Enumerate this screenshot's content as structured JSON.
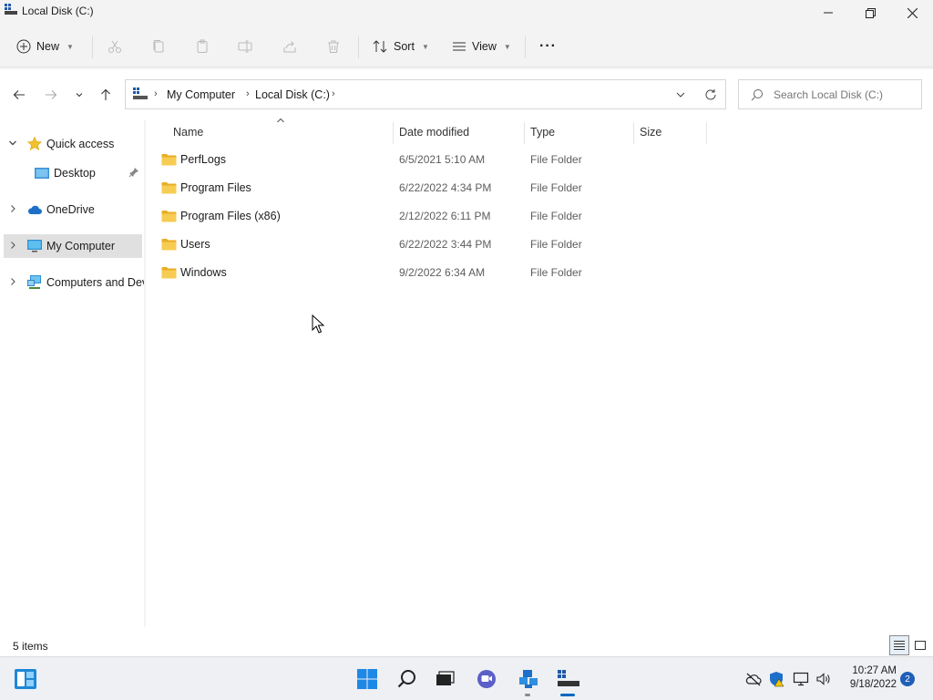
{
  "window": {
    "title": "Local Disk (C:)"
  },
  "commandbar": {
    "new_label": "New",
    "sort_label": "Sort",
    "view_label": "View",
    "more_label": "···"
  },
  "address": {
    "crumbs": [
      "My Computer",
      "Local Disk (C:)"
    ],
    "separator": "›"
  },
  "search": {
    "placeholder": "Search Local Disk (C:)"
  },
  "navpane": {
    "items": [
      {
        "label": "Quick access",
        "icon": "star-icon"
      },
      {
        "label": "Desktop",
        "icon": "desktop-folder-icon"
      },
      {
        "label": "OneDrive",
        "icon": "cloud-icon"
      },
      {
        "label": "My Computer",
        "icon": "computer-icon"
      },
      {
        "label": "Computers and Devices",
        "icon": "network-icon"
      }
    ]
  },
  "filelist": {
    "columns": [
      "Name",
      "Date modified",
      "Type",
      "Size"
    ],
    "rows": [
      {
        "name": "PerfLogs",
        "date": "6/5/2021 5:10 AM",
        "type": "File Folder",
        "size": ""
      },
      {
        "name": "Program Files",
        "date": "6/22/2022 4:34 PM",
        "type": "File Folder",
        "size": ""
      },
      {
        "name": "Program Files (x86)",
        "date": "2/12/2022 6:11 PM",
        "type": "File Folder",
        "size": ""
      },
      {
        "name": "Users",
        "date": "6/22/2022 3:44 PM",
        "type": "File Folder",
        "size": ""
      },
      {
        "name": "Windows",
        "date": "9/2/2022 6:34 AM",
        "type": "File Folder",
        "size": ""
      }
    ]
  },
  "status": {
    "item_count": "5 items"
  },
  "taskbar": {
    "time": "10:27 AM",
    "date": "9/18/2022",
    "notification_count": "2"
  },
  "colors": {
    "accent": "#0067c0",
    "folder": "#f3c445",
    "selection": "#e0e0e0"
  }
}
